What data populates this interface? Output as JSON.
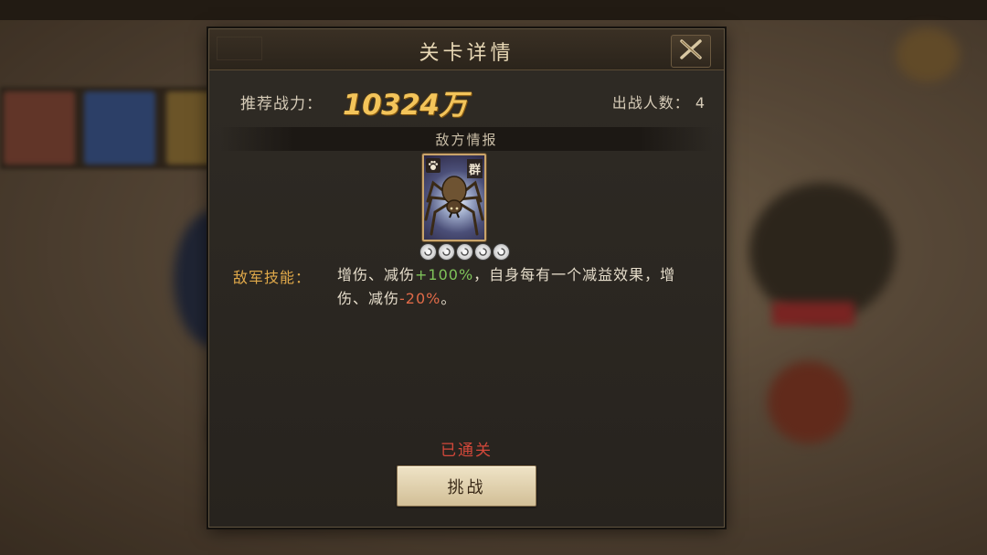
{
  "dialog": {
    "title": "关卡详情",
    "power_label": "推荐战力：",
    "power_value": "10324万",
    "team_size_label": "出战人数：",
    "team_size_value": "4",
    "section_title": "敌方情报",
    "enemy": {
      "type_tag": "群",
      "icon": "spider-icon",
      "stars": 5
    },
    "skill": {
      "label": "敌军技能：",
      "text_1": "增伤、减伤",
      "value_1": "+100%",
      "text_2": "，自身每有一个减益效果，增伤、减伤",
      "value_2": "-20%",
      "text_3": "。"
    },
    "status": "已通关",
    "challenge_button": "挑战"
  },
  "colors": {
    "power": "#f3c45a",
    "positive": "#7fc35a",
    "negative": "#e06a48",
    "cleared": "#d4483a",
    "skill_label": "#e0a94a"
  }
}
